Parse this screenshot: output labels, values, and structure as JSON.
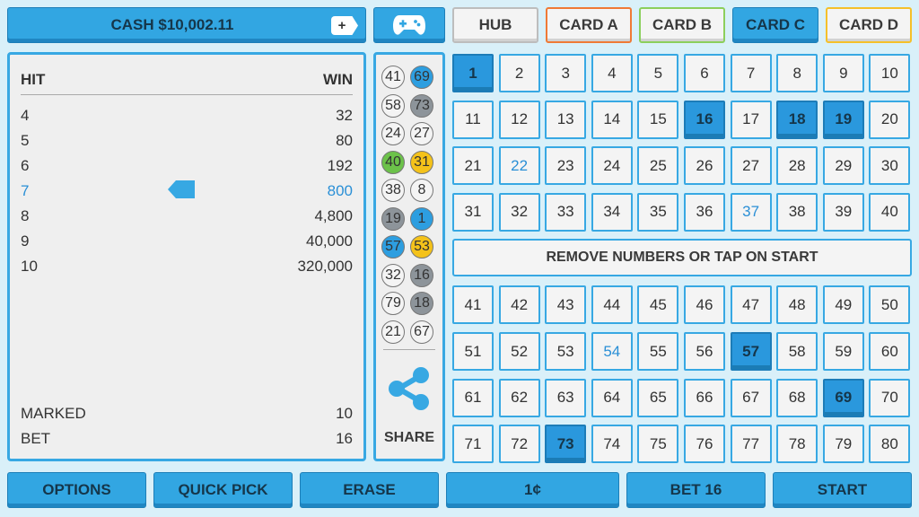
{
  "header": {
    "cash_label": "CASH $10,002.11",
    "add_label": "+",
    "tabs": [
      {
        "label": "HUB",
        "color": "#bdbdbd"
      },
      {
        "label": "CARD A",
        "color": "#ef7a36"
      },
      {
        "label": "CARD B",
        "color": "#8ccf5c"
      },
      {
        "label": "CARD C",
        "color": "#2d9ee0"
      },
      {
        "label": "CARD D",
        "color": "#f5c02a"
      }
    ],
    "active_tab": "CARD C"
  },
  "paytable": {
    "hit_header": "HIT",
    "win_header": "WIN",
    "rows": [
      {
        "hit": "4",
        "win": "32"
      },
      {
        "hit": "5",
        "win": "80"
      },
      {
        "hit": "6",
        "win": "192"
      },
      {
        "hit": "7",
        "win": "800"
      },
      {
        "hit": "8",
        "win": "4,800"
      },
      {
        "hit": "9",
        "win": "40,000"
      },
      {
        "hit": "10",
        "win": "320,000"
      }
    ],
    "highlighted_hit": "7",
    "marked_label": "MARKED",
    "marked_value": "10",
    "bet_label": "BET",
    "bet_value": "16"
  },
  "drawn_balls": [
    {
      "number": "41",
      "color": "white"
    },
    {
      "number": "69",
      "color": "blue"
    },
    {
      "number": "58",
      "color": "white"
    },
    {
      "number": "73",
      "color": "gray"
    },
    {
      "number": "24",
      "color": "white"
    },
    {
      "number": "27",
      "color": "white"
    },
    {
      "number": "40",
      "color": "green"
    },
    {
      "number": "31",
      "color": "yellow"
    },
    {
      "number": "38",
      "color": "white"
    },
    {
      "number": "8",
      "color": "white"
    },
    {
      "number": "19",
      "color": "gray"
    },
    {
      "number": "1",
      "color": "blue"
    },
    {
      "number": "57",
      "color": "blue"
    },
    {
      "number": "53",
      "color": "yellow"
    },
    {
      "number": "32",
      "color": "white"
    },
    {
      "number": "16",
      "color": "gray"
    },
    {
      "number": "79",
      "color": "white"
    },
    {
      "number": "18",
      "color": "gray"
    },
    {
      "number": "21",
      "color": "white"
    },
    {
      "number": "67",
      "color": "white"
    }
  ],
  "share": {
    "icon": "share-icon",
    "label": "SHARE"
  },
  "board": {
    "selected": [
      "1",
      "16",
      "18",
      "19",
      "57",
      "69",
      "73"
    ],
    "highlighted": [
      "22",
      "37",
      "54"
    ],
    "banner": "REMOVE NUMBERS OR TAP ON START"
  },
  "bottom_bar": {
    "options": "OPTIONS",
    "quick_pick": "QUICK PICK",
    "erase": "ERASE",
    "denomination": "1¢",
    "bet": "BET 16",
    "start": "START"
  }
}
